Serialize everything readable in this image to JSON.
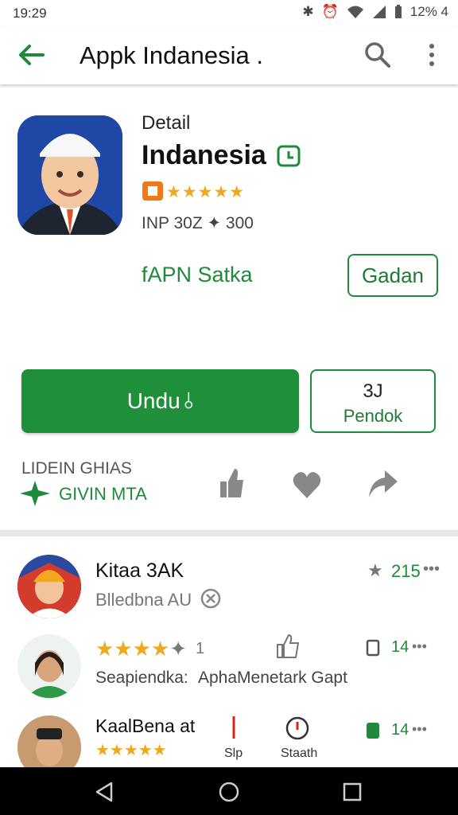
{
  "status": {
    "time": "19:29",
    "battery": "12% 4"
  },
  "appbar": {
    "title": "Appk Indanesia ."
  },
  "detail": {
    "label": "Detail",
    "app_name": "Indanesia",
    "rating_stars": "★★★★★",
    "meta": "INP 30Z ✦ 300",
    "tagline": "fAPN Satka",
    "secondary_button": "Gadan"
  },
  "actions": {
    "install_label": "Undu",
    "count_top": "3J",
    "count_bottom": "Pendok"
  },
  "stats": {
    "line1": "LIDEIN GHIAS",
    "line2": "GIVIN MTA"
  },
  "list": [
    {
      "title": "Kitaa 3AK",
      "subtitle": "Blledbna AU",
      "rating": "215"
    },
    {
      "title": "",
      "subtitle": "Seapiendka:",
      "subtitle2": "AphaMenetark Gapt",
      "stars_suffix": "1",
      "right": "14"
    },
    {
      "title": "KaalBena at",
      "stars": "★★★★★",
      "right": "14",
      "chip1": "Slp",
      "chip2": "Staath"
    }
  ],
  "colors": {
    "accent": "#1f8f3a",
    "star": "#f0a81c"
  }
}
